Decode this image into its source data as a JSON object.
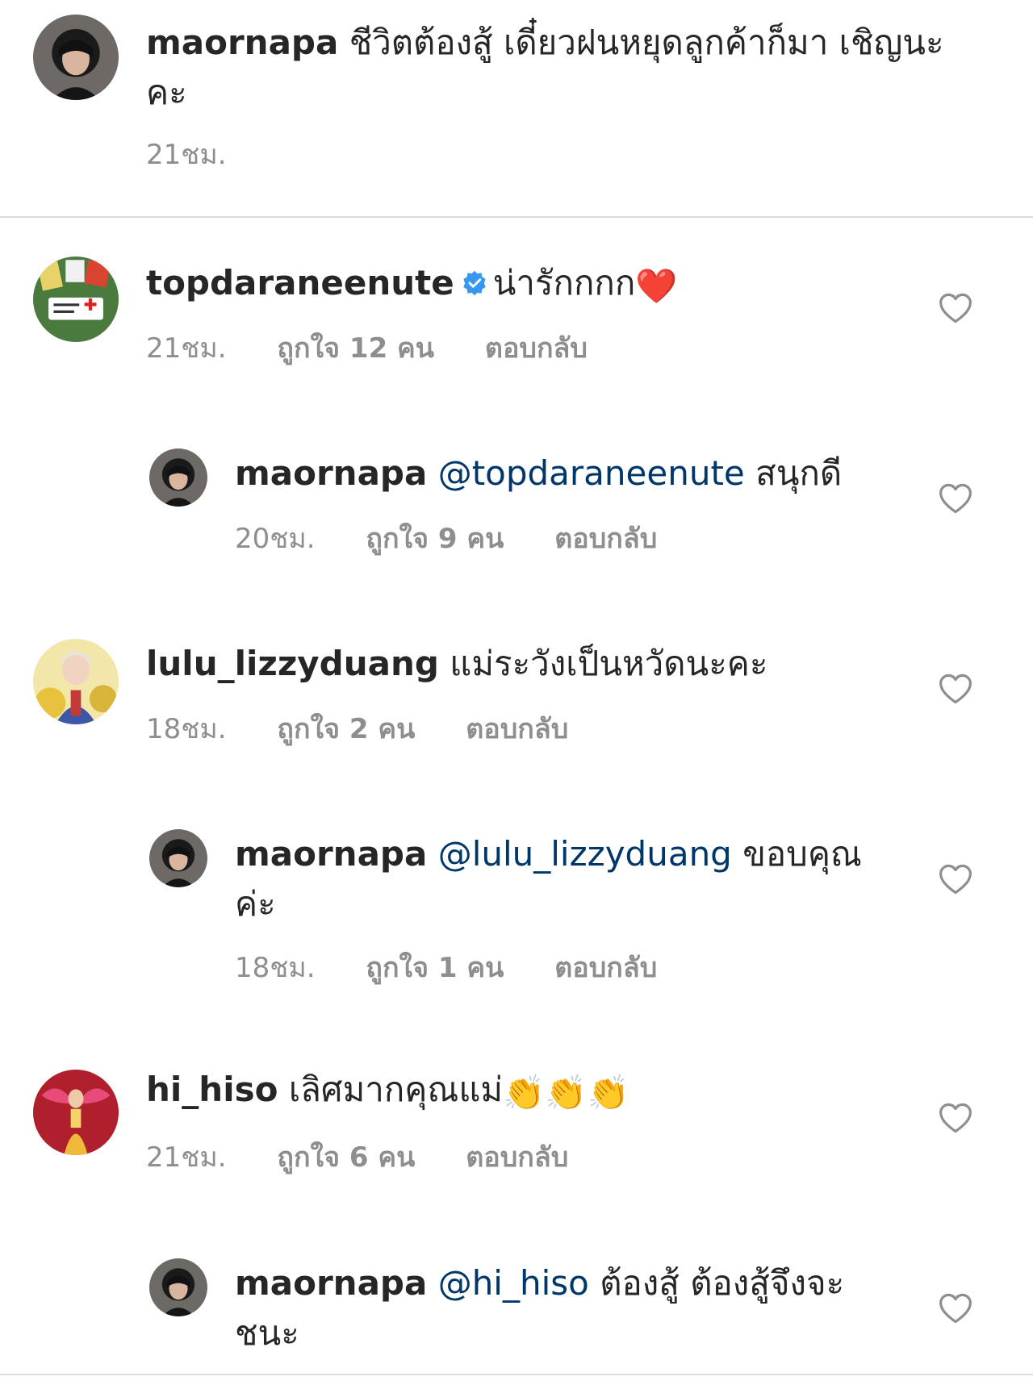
{
  "caption": {
    "username": "maornapa",
    "text_line1": "ชีวิตต้องสู้ เดี๋ยวฝนหยุดลูกค้าก็มา เชิญนะ",
    "text_line2": "คะ",
    "time": "21ชม."
  },
  "comments": [
    {
      "username": "topdaraneenute",
      "verified": true,
      "text": "น่ารักกกก",
      "emoji": "❤️",
      "time": "21ชม.",
      "likes": "ถูกใจ 12 คน",
      "reply_label": "ตอบกลับ"
    },
    {
      "username": "maornapa",
      "mention": "@topdaraneenute",
      "text": "สนุกดี",
      "time": "20ชม.",
      "likes": "ถูกใจ 9 คน",
      "reply_label": "ตอบกลับ"
    },
    {
      "username": "lulu_lizzyduang",
      "text": "แม่ระวังเป็นหวัดนะคะ",
      "time": "18ชม.",
      "likes": "ถูกใจ 2 คน",
      "reply_label": "ตอบกลับ"
    },
    {
      "username": "maornapa",
      "mention": "@lulu_lizzyduang",
      "text": "ขอบคุณ",
      "text_line2": "ค่ะ",
      "time": "18ชม.",
      "likes": "ถูกใจ 1 คน",
      "reply_label": "ตอบกลับ"
    },
    {
      "username": "hi_hiso",
      "text": "เลิศมากคุณแม่",
      "emoji": "👏👏👏",
      "time": "21ชม.",
      "likes": "ถูกใจ 6 คน",
      "reply_label": "ตอบกลับ"
    },
    {
      "username": "maornapa",
      "mention": "@hi_hiso",
      "text": "ต้องสู้ ต้องสู้จึงจะ",
      "text_line2": "ชนะ"
    }
  ],
  "colors": {
    "text": "#262626",
    "muted": "#8e8e8e",
    "mention": "#00376b",
    "verified": "#3897f0",
    "divider": "#dbdbdb"
  },
  "icons": {
    "like": "heart-outline-icon",
    "verified": "verified-badge-icon"
  }
}
